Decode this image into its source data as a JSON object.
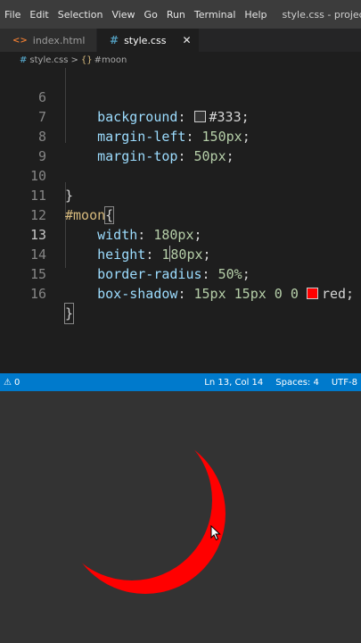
{
  "menu": {
    "items": [
      "File",
      "Edit",
      "Selection",
      "View",
      "Go",
      "Run",
      "Terminal",
      "Help"
    ],
    "window_title": "style.css - project video"
  },
  "tabs": [
    {
      "label": "index.html",
      "icon": "html-icon",
      "icon_glyph": "<>"
    },
    {
      "label": "style.css",
      "icon": "css-icon",
      "icon_glyph": "#",
      "close": "✕"
    }
  ],
  "breadcrumb": {
    "file": "style.css",
    "file_glyph": "#",
    "separator": ">",
    "symbol_glyph": "{}",
    "symbol": "#moon"
  },
  "editor": {
    "current_line": 13,
    "lines": [
      {
        "num": "6",
        "prop": "background",
        "value": "#333",
        "swatch": "#333333"
      },
      {
        "num": "7",
        "prop": "margin-left",
        "value": "150px"
      },
      {
        "num": "8",
        "prop": "margin-top",
        "value": "50px"
      },
      {
        "num": "9"
      },
      {
        "num": "10",
        "text": "}"
      },
      {
        "num": "11",
        "selector": "#moon",
        "brace": "{"
      },
      {
        "num": "12",
        "prop": "width",
        "value": "180px"
      },
      {
        "num": "13",
        "prop": "height",
        "value_before_cursor": "1",
        "value_after_cursor": "80px"
      },
      {
        "num": "14",
        "prop": "border-radius",
        "value": "50%"
      },
      {
        "num": "15",
        "prop": "box-shadow",
        "value_prefix": "15px 15px 0 0",
        "swatch": "#ff0000",
        "value": "red"
      },
      {
        "num": "16",
        "text": "}"
      }
    ]
  },
  "status": {
    "problems": "0",
    "position": "Ln 13, Col 14",
    "spaces": "Spaces: 4",
    "encoding": "UTF-8"
  },
  "colors": {
    "status_bar": "#007acc",
    "editor_bg": "#1e1e1e",
    "preview_bg": "#333333",
    "moon_shadow": "#ff0000"
  }
}
